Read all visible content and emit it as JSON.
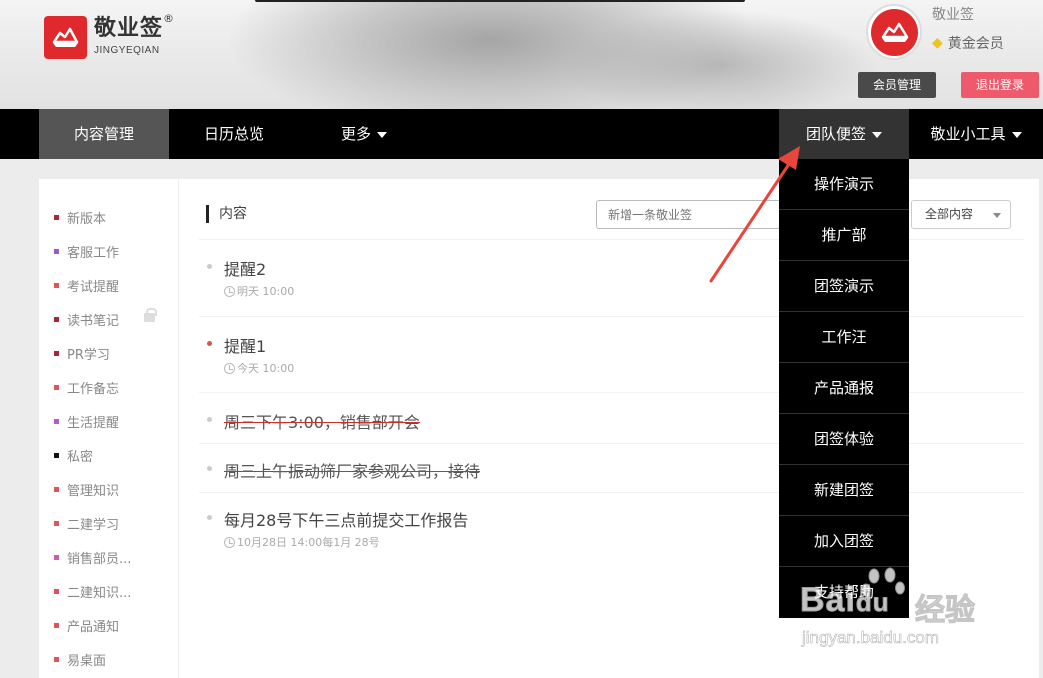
{
  "header": {
    "logo_cn": "敬业签",
    "logo_reg": "®",
    "logo_en": "JINGYEQIAN",
    "user_name": "敬业签",
    "member_level": "黄金会员",
    "member_manage_button": "会员管理",
    "logout_button": "退出登录"
  },
  "nav": {
    "content_manage": "内容管理",
    "calendar": "日历总览",
    "more": "更多",
    "team_note": "团队便签",
    "tools": "敬业小工具"
  },
  "sidebar": {
    "items": [
      {
        "label": "新版本",
        "color": "#b0243a"
      },
      {
        "label": "客服工作",
        "color": "#9b59d0"
      },
      {
        "label": "考试提醒",
        "color": "#e0525c"
      },
      {
        "label": "读书笔记",
        "color": "#a8243a",
        "locked": true
      },
      {
        "label": "PR学习",
        "color": "#a8243a"
      },
      {
        "label": "工作备忘",
        "color": "#e0525c"
      },
      {
        "label": "生活提醒",
        "color": "#b05cd0"
      },
      {
        "label": "私密",
        "color": "#111111"
      },
      {
        "label": "管理知识",
        "color": "#e0525c"
      },
      {
        "label": "二建学习",
        "color": "#e0525c"
      },
      {
        "label": "销售部员...",
        "color": "#d05ca8"
      },
      {
        "label": "二建知识...",
        "color": "#e0525c"
      },
      {
        "label": "产品通知",
        "color": "#e0525c"
      },
      {
        "label": "易桌面",
        "color": "#e0525c"
      }
    ]
  },
  "main": {
    "title": "内容",
    "new_placeholder": "新增一条敬业签",
    "filter_value": "全部内容",
    "todos": [
      {
        "title": "提醒2",
        "time": "明天 10:00",
        "done": false
      },
      {
        "title": "提醒1",
        "time": "今天 10:00",
        "done": false,
        "bullet": "red"
      },
      {
        "title": "周三下午3:00，销售部开会",
        "time": "",
        "done": true
      },
      {
        "title": "周三上午振动筛厂家参观公司，接待",
        "time": "",
        "done": true
      },
      {
        "title": "每月28号下午三点前提交工作报告",
        "time": "10月28日 14:00每1月 28号",
        "done": false
      }
    ]
  },
  "team_dropdown": {
    "items": [
      "操作演示",
      "推广部",
      "团签演示",
      "工作汪",
      "产品通报",
      "团签体验",
      "新建团签",
      "加入团签",
      "支持帮助"
    ]
  },
  "watermark": {
    "brand": "Bai",
    "brand2": "du",
    "cn": "经验",
    "url": "jingyan.baidu.com"
  },
  "colors": {
    "nav_bg": "#000000",
    "accent_red": "#e0292c",
    "logout_pink": "#ee5a6c",
    "annotation_arrow": "#e8453c"
  }
}
